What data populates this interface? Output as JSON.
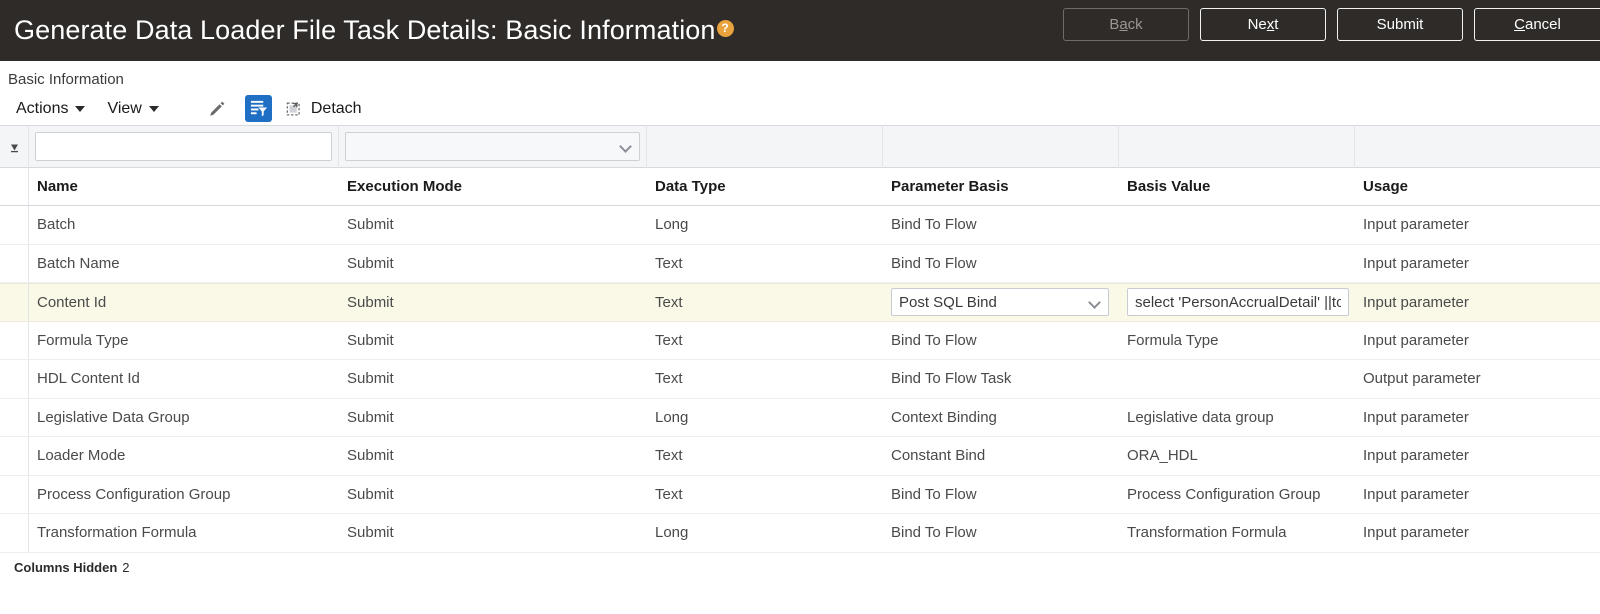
{
  "app_bar": {
    "title": "Generate Data Loader File Task Details: Basic Information",
    "help_icon": "help-circle-icon",
    "help_glyph": "?",
    "buttons": [
      {
        "name": "back-button",
        "label_pre": "B",
        "label_key": "a",
        "label_post": "ck",
        "disabled": true
      },
      {
        "name": "next-button",
        "label_pre": "Ne",
        "label_key": "x",
        "label_post": "t",
        "disabled": false
      },
      {
        "name": "submit-button",
        "label_pre": "Submit",
        "label_key": "",
        "label_post": "",
        "disabled": false
      },
      {
        "name": "cancel-button",
        "label_pre": "",
        "label_key": "C",
        "label_post": "ancel",
        "disabled": false
      }
    ],
    "background_color": "#2e2b28",
    "help_color": "#e8a33d"
  },
  "section": {
    "title": "Basic Information"
  },
  "toolbar": {
    "actions_label": "Actions",
    "view_label": "View",
    "edit_icon": "pencil-icon",
    "qbe_icon": "query-by-example-filter-icon",
    "detach_icon": "detach-icon",
    "detach_label": "Detach",
    "qbe_active_color": "#1f6fc4"
  },
  "filter_row": {
    "sort_marker_icon": "sort-indicator-icon",
    "name_value": "",
    "name_placeholder": "",
    "execution_mode_value": "",
    "data_type_value": "",
    "parameter_basis_value": "",
    "basis_value_value": "",
    "usage_value": ""
  },
  "table": {
    "columns": [
      "Name",
      "Execution Mode",
      "Data Type",
      "Parameter Basis",
      "Basis Value",
      "Usage"
    ],
    "rows": [
      {
        "name": "Batch",
        "execution_mode": "Submit",
        "data_type": "Long",
        "parameter_basis": "Bind To Flow",
        "basis_value": "",
        "usage": "Input parameter",
        "selected": false
      },
      {
        "name": "Batch Name",
        "execution_mode": "Submit",
        "data_type": "Text",
        "parameter_basis": "Bind To Flow",
        "basis_value": "",
        "usage": "Input parameter",
        "selected": false
      },
      {
        "name": "Content Id",
        "execution_mode": "Submit",
        "data_type": "Text",
        "parameter_basis": "Post SQL Bind",
        "basis_value": "select 'PersonAccrualDetail' ||to",
        "usage": "Input parameter",
        "selected": true
      },
      {
        "name": "Formula Type",
        "execution_mode": "Submit",
        "data_type": "Text",
        "parameter_basis": "Bind To Flow",
        "basis_value": "Formula Type",
        "usage": "Input parameter",
        "selected": false
      },
      {
        "name": "HDL Content Id",
        "execution_mode": "Submit",
        "data_type": "Text",
        "parameter_basis": "Bind To Flow Task",
        "basis_value": "",
        "usage": "Output parameter",
        "selected": false
      },
      {
        "name": "Legislative Data Group",
        "execution_mode": "Submit",
        "data_type": "Long",
        "parameter_basis": "Context Binding",
        "basis_value": "Legislative data group",
        "usage": "Input parameter",
        "selected": false
      },
      {
        "name": "Loader Mode",
        "execution_mode": "Submit",
        "data_type": "Text",
        "parameter_basis": "Constant Bind",
        "basis_value": "ORA_HDL",
        "usage": "Input parameter",
        "selected": false
      },
      {
        "name": "Process Configuration Group",
        "execution_mode": "Submit",
        "data_type": "Text",
        "parameter_basis": "Bind To Flow",
        "basis_value": "Process Configuration Group",
        "usage": "Input parameter",
        "selected": false
      },
      {
        "name": "Transformation Formula",
        "execution_mode": "Submit",
        "data_type": "Long",
        "parameter_basis": "Bind To Flow",
        "basis_value": "Transformation Formula",
        "usage": "Input parameter",
        "selected": false
      }
    ],
    "footer": {
      "columns_hidden_label": "Columns Hidden",
      "columns_hidden_count": "2"
    }
  }
}
